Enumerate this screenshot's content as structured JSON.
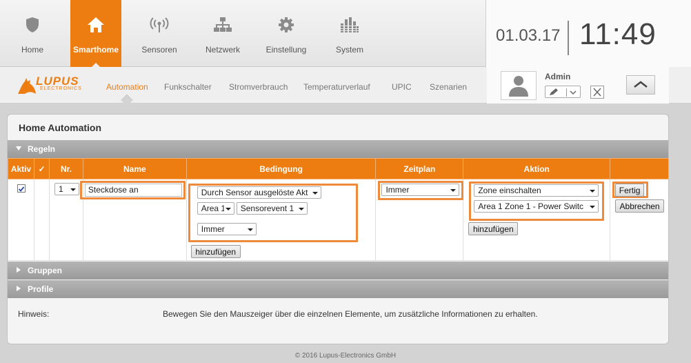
{
  "top_nav": {
    "items": [
      {
        "label": "Home",
        "icon": "shield-icon"
      },
      {
        "label": "Smarthome",
        "icon": "house-icon",
        "active": true
      },
      {
        "label": "Sensoren",
        "icon": "antenna-icon"
      },
      {
        "label": "Netzwerk",
        "icon": "network-icon"
      },
      {
        "label": "Einstellung",
        "icon": "gear-icon"
      },
      {
        "label": "System",
        "icon": "bars-icon"
      }
    ],
    "active_color": "#ee7d11"
  },
  "clock": {
    "date": "01.03.17",
    "time": "11:49"
  },
  "sub_nav": {
    "logo_text": "LUPUS",
    "logo_subtext": "ELECTRONICS",
    "tabs": [
      "Automation",
      "Funkschalter",
      "Stromverbrauch",
      "Temperaturverlauf",
      "UPIC",
      "Szenarien"
    ],
    "active_tab": "Automation"
  },
  "user": {
    "name": "Admin"
  },
  "panel": {
    "title": "Home Automation",
    "sections": {
      "regeln": "Regeln",
      "gruppen": "Gruppen",
      "profile": "Profile"
    },
    "table": {
      "headers": [
        "Aktiv",
        "✓",
        "Nr.",
        "Name",
        "Bedingung",
        "Zeitplan",
        "Aktion",
        ""
      ],
      "row": {
        "active_checked": true,
        "nr": "1",
        "name": "Steckdose an",
        "condition_type": "Durch Sensor ausgelöste Akt",
        "condition_area": "Area 1",
        "condition_event": "Sensorevent 1",
        "condition_schedule": "Immer",
        "schedule": "Immer",
        "action_type": "Zone einschalten",
        "action_target": "Area 1 Zone 1 - Power Switc",
        "add_label": "hinzufügen",
        "done_label": "Fertig",
        "cancel_label": "Abbrechen"
      }
    },
    "hint_label": "Hinweis:",
    "hint_text": "Bewegen Sie den Mauszeiger über die einzelnen Elemente, um zusätzliche Informationen zu erhalten."
  },
  "footer": "© 2016 Lupus-Electronics GmbH"
}
